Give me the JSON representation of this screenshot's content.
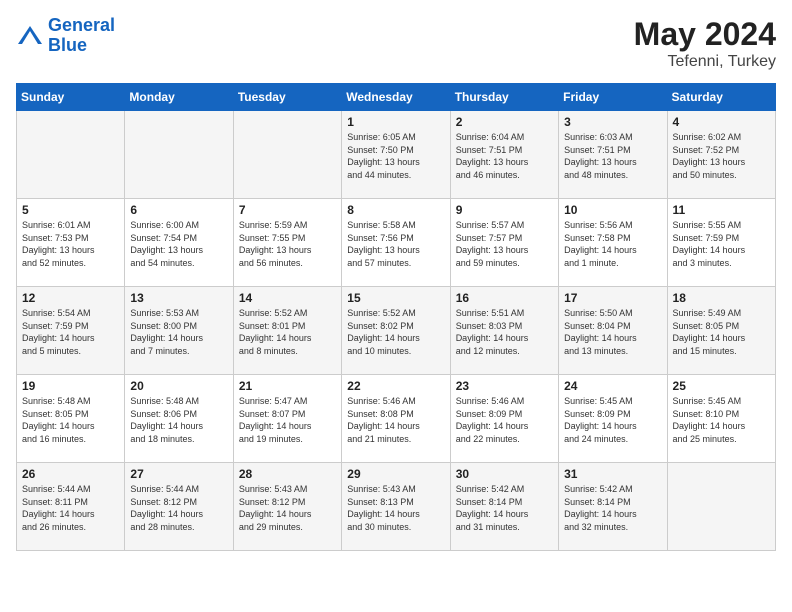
{
  "header": {
    "logo_line1": "General",
    "logo_line2": "Blue",
    "month": "May 2024",
    "location": "Tefenni, Turkey"
  },
  "weekdays": [
    "Sunday",
    "Monday",
    "Tuesday",
    "Wednesday",
    "Thursday",
    "Friday",
    "Saturday"
  ],
  "weeks": [
    [
      {
        "day": "",
        "info": ""
      },
      {
        "day": "",
        "info": ""
      },
      {
        "day": "",
        "info": ""
      },
      {
        "day": "1",
        "info": "Sunrise: 6:05 AM\nSunset: 7:50 PM\nDaylight: 13 hours\nand 44 minutes."
      },
      {
        "day": "2",
        "info": "Sunrise: 6:04 AM\nSunset: 7:51 PM\nDaylight: 13 hours\nand 46 minutes."
      },
      {
        "day": "3",
        "info": "Sunrise: 6:03 AM\nSunset: 7:51 PM\nDaylight: 13 hours\nand 48 minutes."
      },
      {
        "day": "4",
        "info": "Sunrise: 6:02 AM\nSunset: 7:52 PM\nDaylight: 13 hours\nand 50 minutes."
      }
    ],
    [
      {
        "day": "5",
        "info": "Sunrise: 6:01 AM\nSunset: 7:53 PM\nDaylight: 13 hours\nand 52 minutes."
      },
      {
        "day": "6",
        "info": "Sunrise: 6:00 AM\nSunset: 7:54 PM\nDaylight: 13 hours\nand 54 minutes."
      },
      {
        "day": "7",
        "info": "Sunrise: 5:59 AM\nSunset: 7:55 PM\nDaylight: 13 hours\nand 56 minutes."
      },
      {
        "day": "8",
        "info": "Sunrise: 5:58 AM\nSunset: 7:56 PM\nDaylight: 13 hours\nand 57 minutes."
      },
      {
        "day": "9",
        "info": "Sunrise: 5:57 AM\nSunset: 7:57 PM\nDaylight: 13 hours\nand 59 minutes."
      },
      {
        "day": "10",
        "info": "Sunrise: 5:56 AM\nSunset: 7:58 PM\nDaylight: 14 hours\nand 1 minute."
      },
      {
        "day": "11",
        "info": "Sunrise: 5:55 AM\nSunset: 7:59 PM\nDaylight: 14 hours\nand 3 minutes."
      }
    ],
    [
      {
        "day": "12",
        "info": "Sunrise: 5:54 AM\nSunset: 7:59 PM\nDaylight: 14 hours\nand 5 minutes."
      },
      {
        "day": "13",
        "info": "Sunrise: 5:53 AM\nSunset: 8:00 PM\nDaylight: 14 hours\nand 7 minutes."
      },
      {
        "day": "14",
        "info": "Sunrise: 5:52 AM\nSunset: 8:01 PM\nDaylight: 14 hours\nand 8 minutes."
      },
      {
        "day": "15",
        "info": "Sunrise: 5:52 AM\nSunset: 8:02 PM\nDaylight: 14 hours\nand 10 minutes."
      },
      {
        "day": "16",
        "info": "Sunrise: 5:51 AM\nSunset: 8:03 PM\nDaylight: 14 hours\nand 12 minutes."
      },
      {
        "day": "17",
        "info": "Sunrise: 5:50 AM\nSunset: 8:04 PM\nDaylight: 14 hours\nand 13 minutes."
      },
      {
        "day": "18",
        "info": "Sunrise: 5:49 AM\nSunset: 8:05 PM\nDaylight: 14 hours\nand 15 minutes."
      }
    ],
    [
      {
        "day": "19",
        "info": "Sunrise: 5:48 AM\nSunset: 8:05 PM\nDaylight: 14 hours\nand 16 minutes."
      },
      {
        "day": "20",
        "info": "Sunrise: 5:48 AM\nSunset: 8:06 PM\nDaylight: 14 hours\nand 18 minutes."
      },
      {
        "day": "21",
        "info": "Sunrise: 5:47 AM\nSunset: 8:07 PM\nDaylight: 14 hours\nand 19 minutes."
      },
      {
        "day": "22",
        "info": "Sunrise: 5:46 AM\nSunset: 8:08 PM\nDaylight: 14 hours\nand 21 minutes."
      },
      {
        "day": "23",
        "info": "Sunrise: 5:46 AM\nSunset: 8:09 PM\nDaylight: 14 hours\nand 22 minutes."
      },
      {
        "day": "24",
        "info": "Sunrise: 5:45 AM\nSunset: 8:09 PM\nDaylight: 14 hours\nand 24 minutes."
      },
      {
        "day": "25",
        "info": "Sunrise: 5:45 AM\nSunset: 8:10 PM\nDaylight: 14 hours\nand 25 minutes."
      }
    ],
    [
      {
        "day": "26",
        "info": "Sunrise: 5:44 AM\nSunset: 8:11 PM\nDaylight: 14 hours\nand 26 minutes."
      },
      {
        "day": "27",
        "info": "Sunrise: 5:44 AM\nSunset: 8:12 PM\nDaylight: 14 hours\nand 28 minutes."
      },
      {
        "day": "28",
        "info": "Sunrise: 5:43 AM\nSunset: 8:12 PM\nDaylight: 14 hours\nand 29 minutes."
      },
      {
        "day": "29",
        "info": "Sunrise: 5:43 AM\nSunset: 8:13 PM\nDaylight: 14 hours\nand 30 minutes."
      },
      {
        "day": "30",
        "info": "Sunrise: 5:42 AM\nSunset: 8:14 PM\nDaylight: 14 hours\nand 31 minutes."
      },
      {
        "day": "31",
        "info": "Sunrise: 5:42 AM\nSunset: 8:14 PM\nDaylight: 14 hours\nand 32 minutes."
      },
      {
        "day": "",
        "info": ""
      }
    ]
  ]
}
